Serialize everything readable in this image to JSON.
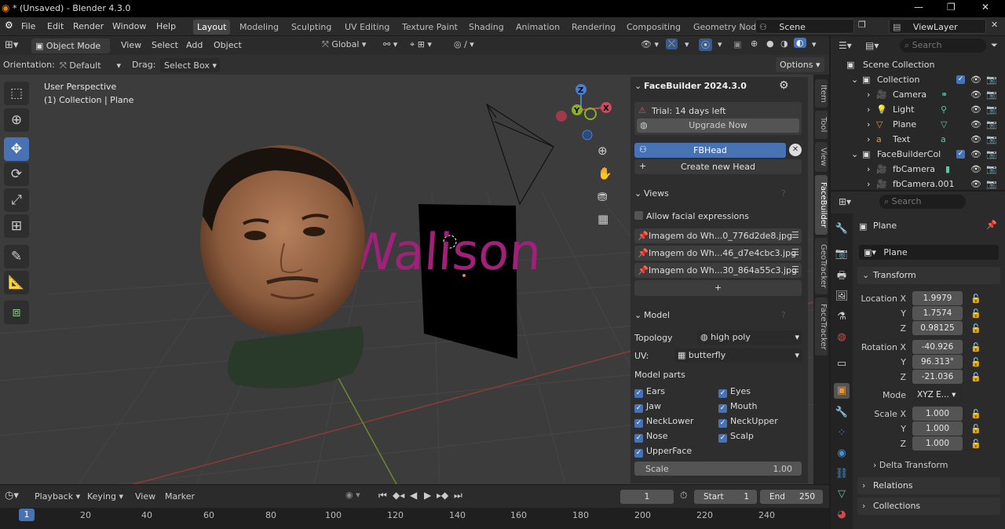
{
  "window": {
    "title": "* (Unsaved) - Blender 4.3.0",
    "min": "—",
    "max": "❐",
    "close": "✕"
  },
  "menu": [
    "File",
    "Edit",
    "Render",
    "Window",
    "Help"
  ],
  "workspaces": [
    "Layout",
    "Modeling",
    "Sculpting",
    "UV Editing",
    "Texture Paint",
    "Shading",
    "Animation",
    "Rendering",
    "Compositing",
    "Geometry Nod"
  ],
  "scene": {
    "label": "Scene",
    "viewlayer": "ViewLayer"
  },
  "header": {
    "mode": "Object Mode",
    "view": "View",
    "select": "Select",
    "add": "Add",
    "object": "Object",
    "transform": "Global"
  },
  "header2": {
    "orientation_label": "Orientation:",
    "orientation_value": "Default",
    "drag_label": "Drag:",
    "drag_value": "Select Box",
    "options": "Options"
  },
  "viewport": {
    "perspective": "User Perspective",
    "collection": "(1) Collection | Plane",
    "text3d": "Walison"
  },
  "facebuilder": {
    "title": "FaceBuilder 2024.3.0",
    "trial": "Trial: 14 days left",
    "upgrade": "Upgrade Now",
    "head": "FBHead",
    "create": "Create new Head",
    "views_title": "Views",
    "allow_expr": "Allow facial expressions",
    "images": [
      "Imagem do Wh...0_776d2de8.jpg",
      "Imagem do Wh...46_d7e4cbc3.jpg",
      "Imagem do Wh...30_864a55c3.jpg"
    ],
    "add": "+",
    "model_title": "Model",
    "topology_label": "Topology",
    "topology_value": "high poly",
    "uv_label": "UV:",
    "uv_value": "butterfly",
    "parts_label": "Model parts",
    "parts_left": [
      "Ears",
      "Jaw",
      "NeckLower",
      "Nose",
      "UpperFace"
    ],
    "parts_right": [
      "Eyes",
      "Mouth",
      "NeckUpper",
      "Scalp"
    ],
    "scale_label": "Scale",
    "scale_value": "1.00"
  },
  "sidetabs": [
    "Item",
    "Tool",
    "View",
    "FaceBuilder",
    "GeoTracker",
    "FaceTracker"
  ],
  "outliner": {
    "search": "Search",
    "rows": [
      "Scene Collection",
      "Collection",
      "Camera",
      "Light",
      "Plane",
      "Text",
      "FaceBuilderCol",
      "fbCamera",
      "fbCamera.001"
    ]
  },
  "properties": {
    "search": "Search",
    "object": "Plane",
    "object_name": "Plane",
    "transform": "Transform",
    "location_label": "Location X",
    "location": [
      "1.9979",
      "1.7574",
      "0.98125"
    ],
    "rotation_label": "Rotation X",
    "rotation": [
      "-40.926",
      "96.313°",
      "-21.036"
    ],
    "mode_label": "Mode",
    "mode_value": "XYZ E...",
    "scale_label": "Scale X",
    "scale": [
      "1.000",
      "1.000",
      "1.000"
    ],
    "y": "Y",
    "z": "Z",
    "delta": "Delta Transform",
    "relations": "Relations",
    "collections": "Collections"
  },
  "timeline": {
    "playback": "Playback",
    "keying": "Keying",
    "view": "View",
    "marker": "Marker",
    "frame": "1",
    "start_label": "Start",
    "start": "1",
    "end_label": "End",
    "end": "250"
  },
  "ruler": {
    "current": "1",
    "ticks": [
      "20",
      "40",
      "60",
      "80",
      "100",
      "120",
      "140",
      "160",
      "180",
      "200",
      "220",
      "240"
    ]
  }
}
